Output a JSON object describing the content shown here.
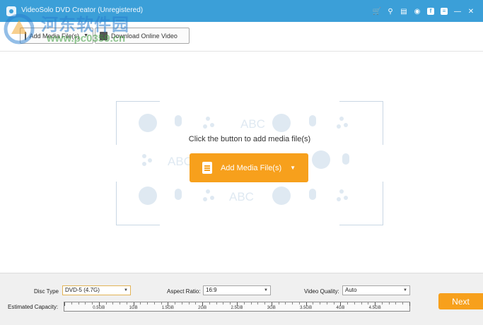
{
  "window": {
    "title": "VideoSolo DVD Creator (Unregistered)",
    "icons": [
      "cart-icon",
      "key-icon",
      "register-icon",
      "feedback-icon",
      "facebook-icon",
      "menu-icon",
      "minimize-icon",
      "close-icon"
    ]
  },
  "watermark": {
    "cn_text": "河东软件园",
    "url": "www.pc0359.cn"
  },
  "toolbar": {
    "add_media_label": "Add Media File(s)",
    "download_label": "Download Online Video"
  },
  "dropzone": {
    "hint": "Click the button to add media file(s)",
    "add_button_label": "Add Media File(s)",
    "pattern_text": "ABC"
  },
  "settings": {
    "disc_type_label": "Disc Type",
    "disc_type_value": "DVD-5 (4.7G)",
    "aspect_ratio_label": "Aspect Ratio:",
    "aspect_ratio_value": "16:9",
    "video_quality_label": "Video Quality:",
    "video_quality_value": "Auto",
    "capacity_label": "Estimated Capacity:",
    "capacity_ticks": [
      "0.5GB",
      "1GB",
      "1.5GB",
      "2GB",
      "2.5GB",
      "3GB",
      "3.5GB",
      "4GB",
      "4.5GB"
    ]
  },
  "next_label": "Next",
  "colors": {
    "titlebar": "#3b9fd8",
    "accent": "#f7a01c"
  }
}
